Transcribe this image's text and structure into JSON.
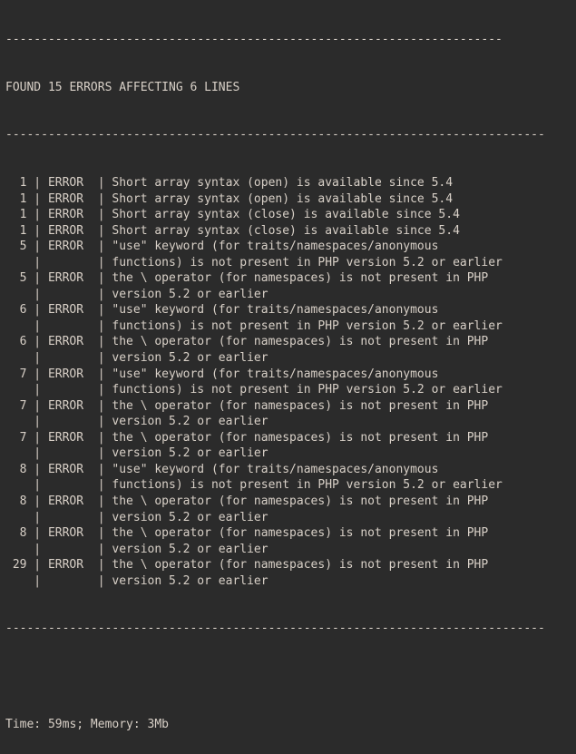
{
  "dash_top_short": "----------------------------------------------------------------------",
  "header": "FOUND 15 ERRORS AFFECTING 6 LINES",
  "dash_full": "----------------------------------------------------------------------------",
  "pipe_pad": " | ",
  "rows": [
    {
      "line": " 1",
      "tag": "ERROR",
      "msg": "Short array syntax (open) is available since 5.4"
    },
    {
      "line": " 1",
      "tag": "ERROR",
      "msg": "Short array syntax (open) is available since 5.4"
    },
    {
      "line": " 1",
      "tag": "ERROR",
      "msg": "Short array syntax (close) is available since 5.4"
    },
    {
      "line": " 1",
      "tag": "ERROR",
      "msg": "Short array syntax (close) is available since 5.4"
    },
    {
      "line": " 5",
      "tag": "ERROR",
      "msg": "\"use\" keyword (for traits/namespaces/anonymous"
    },
    {
      "line": "  ",
      "tag": "     ",
      "msg": "functions) is not present in PHP version 5.2 or earlier"
    },
    {
      "line": " 5",
      "tag": "ERROR",
      "msg": "the \\ operator (for namespaces) is not present in PHP"
    },
    {
      "line": "  ",
      "tag": "     ",
      "msg": "version 5.2 or earlier"
    },
    {
      "line": " 6",
      "tag": "ERROR",
      "msg": "\"use\" keyword (for traits/namespaces/anonymous"
    },
    {
      "line": "  ",
      "tag": "     ",
      "msg": "functions) is not present in PHP version 5.2 or earlier"
    },
    {
      "line": " 6",
      "tag": "ERROR",
      "msg": "the \\ operator (for namespaces) is not present in PHP"
    },
    {
      "line": "  ",
      "tag": "     ",
      "msg": "version 5.2 or earlier"
    },
    {
      "line": " 7",
      "tag": "ERROR",
      "msg": "\"use\" keyword (for traits/namespaces/anonymous"
    },
    {
      "line": "  ",
      "tag": "     ",
      "msg": "functions) is not present in PHP version 5.2 or earlier"
    },
    {
      "line": " 7",
      "tag": "ERROR",
      "msg": "the \\ operator (for namespaces) is not present in PHP"
    },
    {
      "line": "  ",
      "tag": "     ",
      "msg": "version 5.2 or earlier"
    },
    {
      "line": " 7",
      "tag": "ERROR",
      "msg": "the \\ operator (for namespaces) is not present in PHP"
    },
    {
      "line": "  ",
      "tag": "     ",
      "msg": "version 5.2 or earlier"
    },
    {
      "line": " 8",
      "tag": "ERROR",
      "msg": "\"use\" keyword (for traits/namespaces/anonymous"
    },
    {
      "line": "  ",
      "tag": "     ",
      "msg": "functions) is not present in PHP version 5.2 or earlier"
    },
    {
      "line": " 8",
      "tag": "ERROR",
      "msg": "the \\ operator (for namespaces) is not present in PHP"
    },
    {
      "line": "  ",
      "tag": "     ",
      "msg": "version 5.2 or earlier"
    },
    {
      "line": " 8",
      "tag": "ERROR",
      "msg": "the \\ operator (for namespaces) is not present in PHP"
    },
    {
      "line": "  ",
      "tag": "     ",
      "msg": "version 5.2 or earlier"
    },
    {
      "line": "29",
      "tag": "ERROR",
      "msg": "the \\ operator (for namespaces) is not present in PHP"
    },
    {
      "line": "  ",
      "tag": "     ",
      "msg": "version 5.2 or earlier"
    }
  ],
  "footer": "Time: 59ms; Memory: 3Mb"
}
